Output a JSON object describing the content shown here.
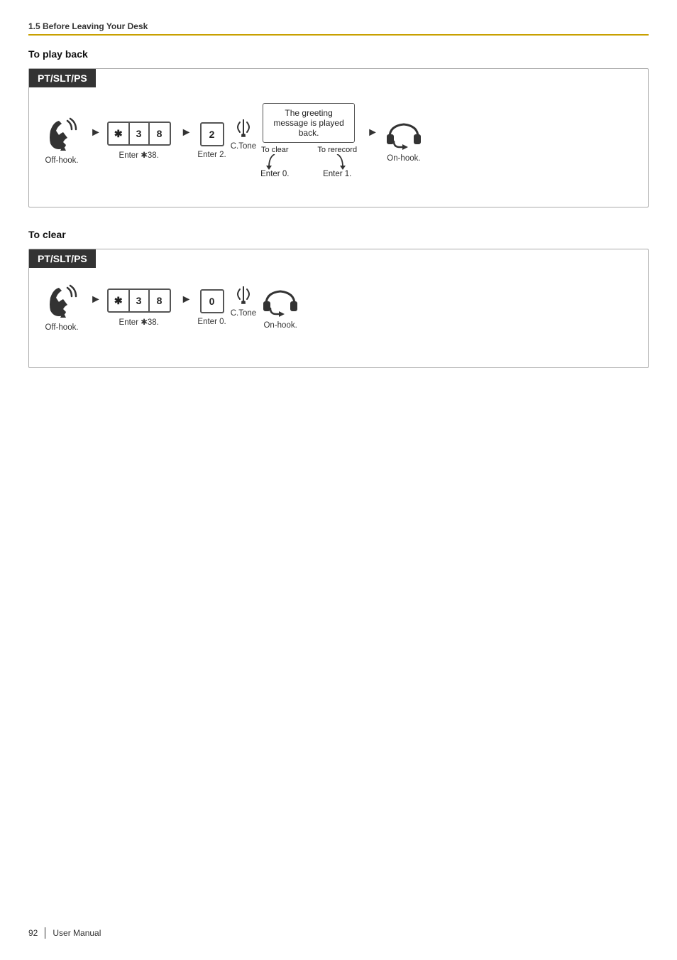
{
  "page": {
    "section": "1.5 Before Leaving Your Desk",
    "playback": {
      "title": "To play back",
      "header": "PT/SLT/PS",
      "steps": [
        {
          "id": "offhook",
          "label": "Off-hook.",
          "type": "phone-off"
        },
        {
          "id": "enter38",
          "label": "Enter ✱38.",
          "type": "key-group",
          "keys": [
            "✱",
            "3",
            "8"
          ]
        },
        {
          "id": "enter2",
          "label": "Enter 2.",
          "type": "key-single",
          "key": "2"
        },
        {
          "id": "ctone",
          "label": "C.Tone",
          "type": "ctone"
        },
        {
          "id": "message",
          "type": "message",
          "text": "The greeting message is played back."
        },
        {
          "id": "onhook",
          "label": "On-hook.",
          "type": "phone-on"
        }
      ],
      "branch_clear_label": "To clear",
      "branch_clear_enter": "Enter 0.",
      "branch_rerecord_label": "To rerecord",
      "branch_rerecord_enter": "Enter 1."
    },
    "clear": {
      "title": "To clear",
      "header": "PT/SLT/PS",
      "steps": [
        {
          "id": "offhook",
          "label": "Off-hook.",
          "type": "phone-off"
        },
        {
          "id": "enter38",
          "label": "Enter ✱38.",
          "type": "key-group",
          "keys": [
            "✱",
            "3",
            "8"
          ]
        },
        {
          "id": "enter0",
          "label": "Enter 0.",
          "type": "key-single",
          "key": "0"
        },
        {
          "id": "ctone",
          "label": "C.Tone",
          "type": "ctone"
        },
        {
          "id": "onhook",
          "label": "On-hook.",
          "type": "phone-on"
        }
      ]
    },
    "footer": {
      "page_number": "92",
      "manual_title": "User Manual"
    }
  }
}
